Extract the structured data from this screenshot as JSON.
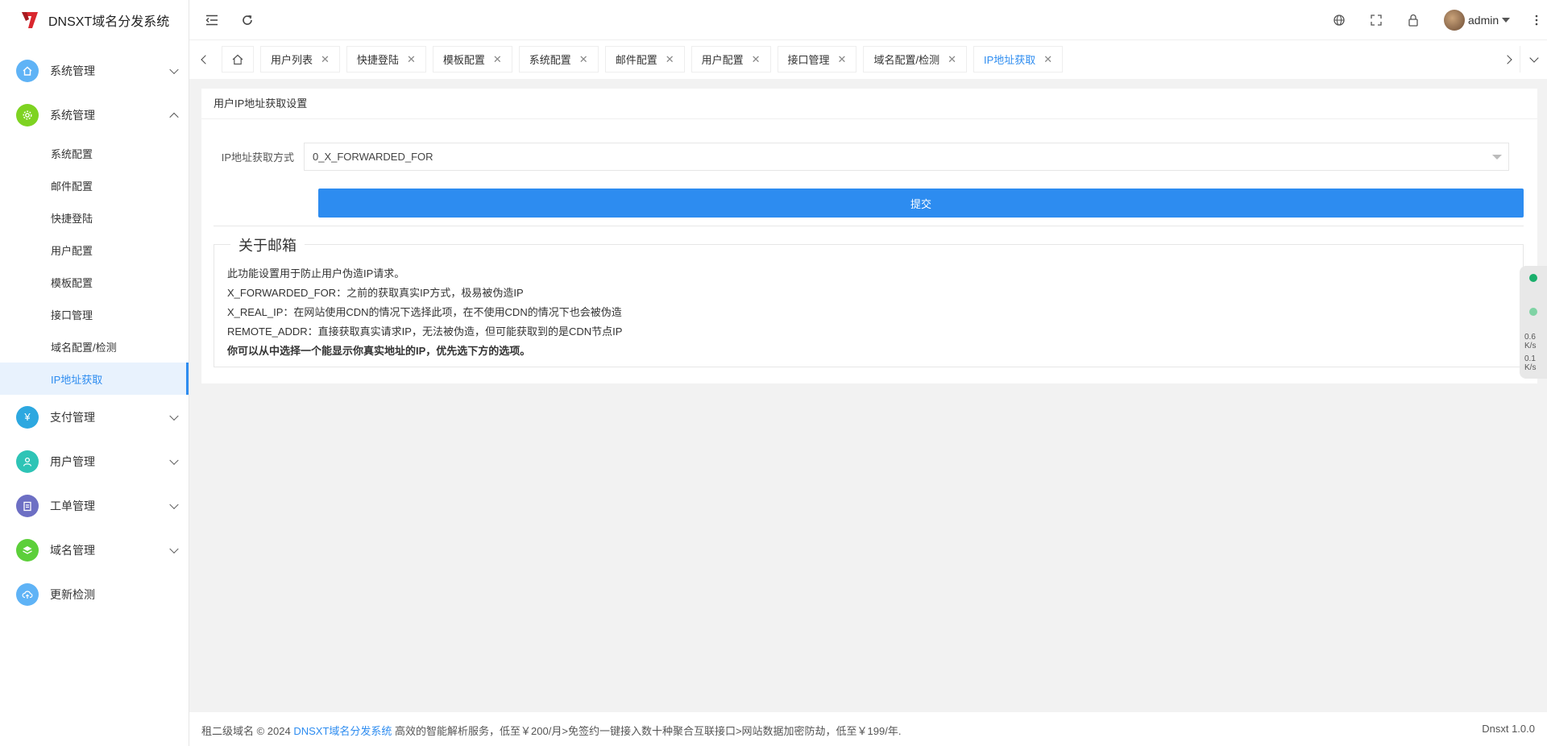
{
  "app": {
    "title": "DNSXT域名分发系统"
  },
  "sidebar": {
    "groups": [
      {
        "label": "系统管理",
        "icon": "home-icon",
        "color": "#5fb3f6",
        "expanded": false
      },
      {
        "label": "系统管理",
        "icon": "gear-icon",
        "color": "#7ed321",
        "expanded": true,
        "items": [
          "系统配置",
          "邮件配置",
          "快捷登陆",
          "用户配置",
          "模板配置",
          "接口管理",
          "域名配置/检测",
          "IP地址获取"
        ],
        "active_item": "IP地址获取"
      },
      {
        "label": "支付管理",
        "icon": "yen-icon",
        "color": "#2da8e0",
        "expanded": false
      },
      {
        "label": "用户管理",
        "icon": "user-icon",
        "color": "#2ec4b6",
        "expanded": false
      },
      {
        "label": "工单管理",
        "icon": "clipboard-icon",
        "color": "#6d6fc4",
        "expanded": false
      },
      {
        "label": "域名管理",
        "icon": "layers-icon",
        "color": "#5ccf3a",
        "expanded": false
      },
      {
        "label": "更新检测",
        "icon": "cloud-upload-icon",
        "color": "#5fb3f6",
        "expanded": false
      }
    ]
  },
  "header": {
    "user_name": "admin"
  },
  "tabs": {
    "items": [
      "用户列表",
      "快捷登陆",
      "模板配置",
      "系统配置",
      "邮件配置",
      "用户配置",
      "接口管理",
      "域名配置/检测",
      "IP地址获取"
    ],
    "active": "IP地址获取"
  },
  "card": {
    "title": "用户IP地址获取设置",
    "form": {
      "label": "IP地址获取方式",
      "selected": "0_X_FORWARDED_FOR",
      "submit": "提交"
    },
    "about": {
      "legend": "关于邮箱",
      "lines": [
        "此功能设置用于防止用户伪造IP请求。",
        "X_FORWARDED_FOR：之前的获取真实IP方式，极易被伪造IP",
        "X_REAL_IP：在网站使用CDN的情况下选择此项，在不使用CDN的情况下也会被伪造",
        "REMOTE_ADDR：直接获取真实请求IP，无法被伪造，但可能获取到的是CDN节点IP"
      ],
      "strong_line": "你可以从中选择一个能显示你真实地址的IP，优先选下方的选项。"
    }
  },
  "net_widget": {
    "up": "0.6",
    "down": "0.1",
    "unit": "K/s"
  },
  "footer": {
    "prefix": "租二级域名 © 2024",
    "link": "DNSXT域名分发系统",
    "suffix": "高效的智能解析服务，低至￥200/月>免签约一键接入数十种聚合互联接口>网站数据加密防劫，低至￥199/年.",
    "version": "Dnsxt 1.0.0"
  },
  "colors": {
    "primary": "#2d8cf0",
    "brand": "#d9272e"
  }
}
